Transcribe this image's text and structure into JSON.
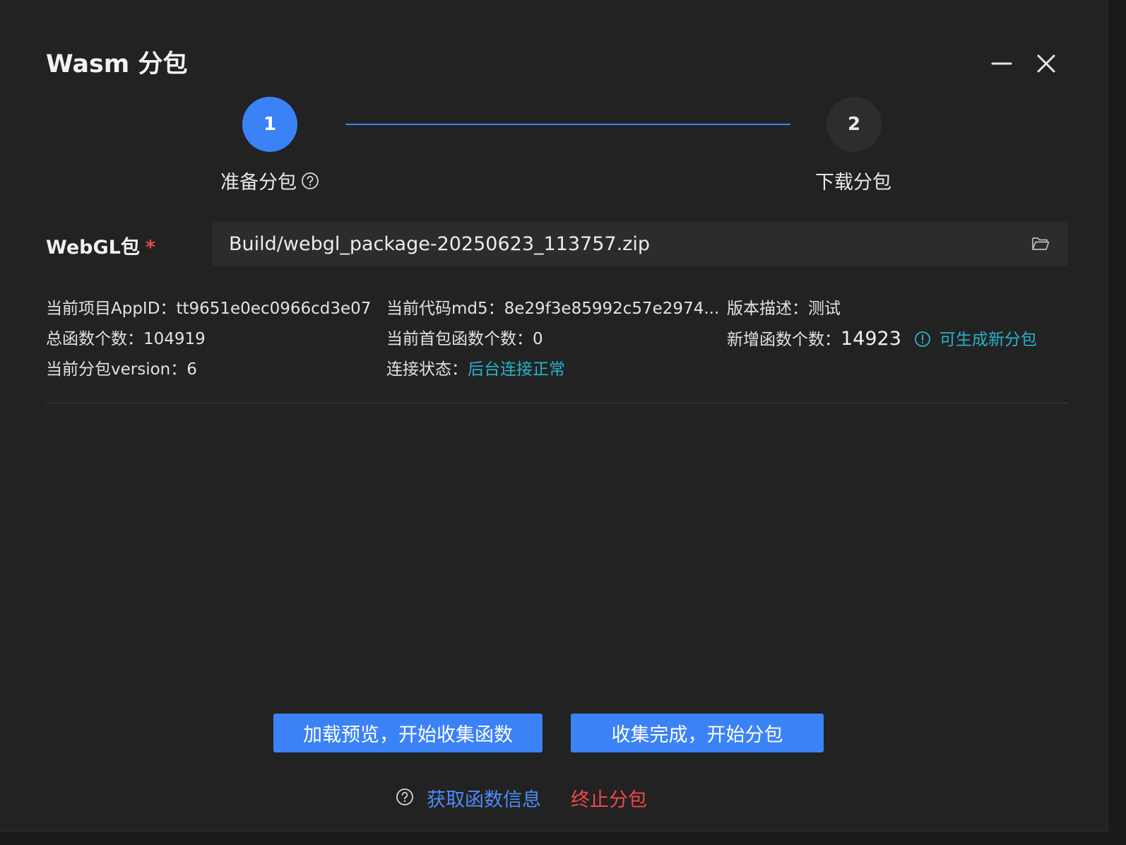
{
  "window": {
    "title": "Wasm 分包",
    "minimize_icon": "minimize-icon",
    "close_icon": "close-icon"
  },
  "steps": [
    {
      "number": "1",
      "label": "准备分包",
      "state": "active"
    },
    {
      "number": "2",
      "label": "下载分包",
      "state": "inactive"
    }
  ],
  "package": {
    "label": "WebGL包",
    "required_mark": "*",
    "value": "Build/webgl_package-20250623_113757.zip",
    "icon": "folder-open-icon"
  },
  "info": {
    "appid_label": "当前项目AppID：",
    "appid_value": "tt9651e0ec0966cd3e07",
    "md5_label": "当前代码md5：",
    "md5_value": "8e29f3e85992c57e2974...",
    "version_desc_label": "版本描述：",
    "version_desc_value": "测试",
    "total_funcs_label": "总函数个数：",
    "total_funcs_value": "104919",
    "first_pkg_funcs_label": "当前首包函数个数：",
    "first_pkg_funcs_value": "0",
    "new_funcs_label": "新增函数个数：",
    "new_funcs_value": "14923",
    "new_pkg_hint": "可生成新分包",
    "split_version_label": "当前分包version：",
    "split_version_value": "6",
    "connection_label": "连接状态：",
    "connection_value": "后台连接正常"
  },
  "actions": {
    "collect_label": "加载预览，开始收集函数",
    "split_label": "收集完成，开始分包",
    "get_info_label": "获取函数信息",
    "stop_label": "终止分包"
  },
  "colors": {
    "accent_blue": "#3b82f6",
    "link_blue": "#4a8df8",
    "teal": "#27b3c8",
    "danger_red": "#f04848",
    "background": "#222223"
  }
}
